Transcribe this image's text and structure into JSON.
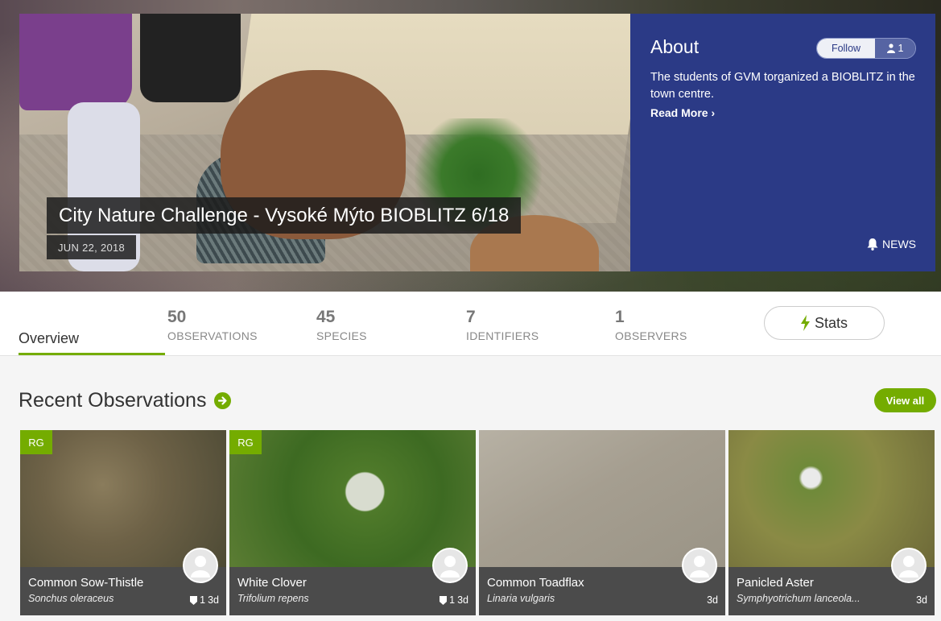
{
  "hero": {
    "title": "City Nature Challenge - Vysoké Mýto BIOBLITZ 6/18",
    "date": "JUN 22, 2018"
  },
  "about": {
    "heading": "About",
    "description": "The students of GVM torganized a BIOBLITZ in the town centre.",
    "read_more": "Read More",
    "follow_label": "Follow",
    "follower_count": "1",
    "news_label": "NEWS"
  },
  "tabs": {
    "overview": "Overview",
    "stats": [
      {
        "value": "50",
        "label": "OBSERVATIONS"
      },
      {
        "value": "45",
        "label": "SPECIES"
      },
      {
        "value": "7",
        "label": "IDENTIFIERS"
      },
      {
        "value": "1",
        "label": "OBSERVERS"
      }
    ],
    "stats_button": "Stats"
  },
  "recent": {
    "title": "Recent Observations",
    "view_all": "View all",
    "cards": [
      {
        "name": "Common Sow-Thistle",
        "scientific": "Sonchus oleraceus",
        "badge": "RG",
        "ids": "1",
        "age": "3d"
      },
      {
        "name": "White Clover",
        "scientific": "Trifolium repens",
        "badge": "RG",
        "ids": "1",
        "age": "3d"
      },
      {
        "name": "Common Toadflax",
        "scientific": "Linaria vulgaris",
        "age": "3d"
      },
      {
        "name": "Panicled Aster",
        "scientific": "Symphyotrichum lanceola...",
        "age": "3d"
      }
    ]
  },
  "colors": {
    "accent_green": "#74ac00",
    "about_blue": "#2b3a86"
  }
}
